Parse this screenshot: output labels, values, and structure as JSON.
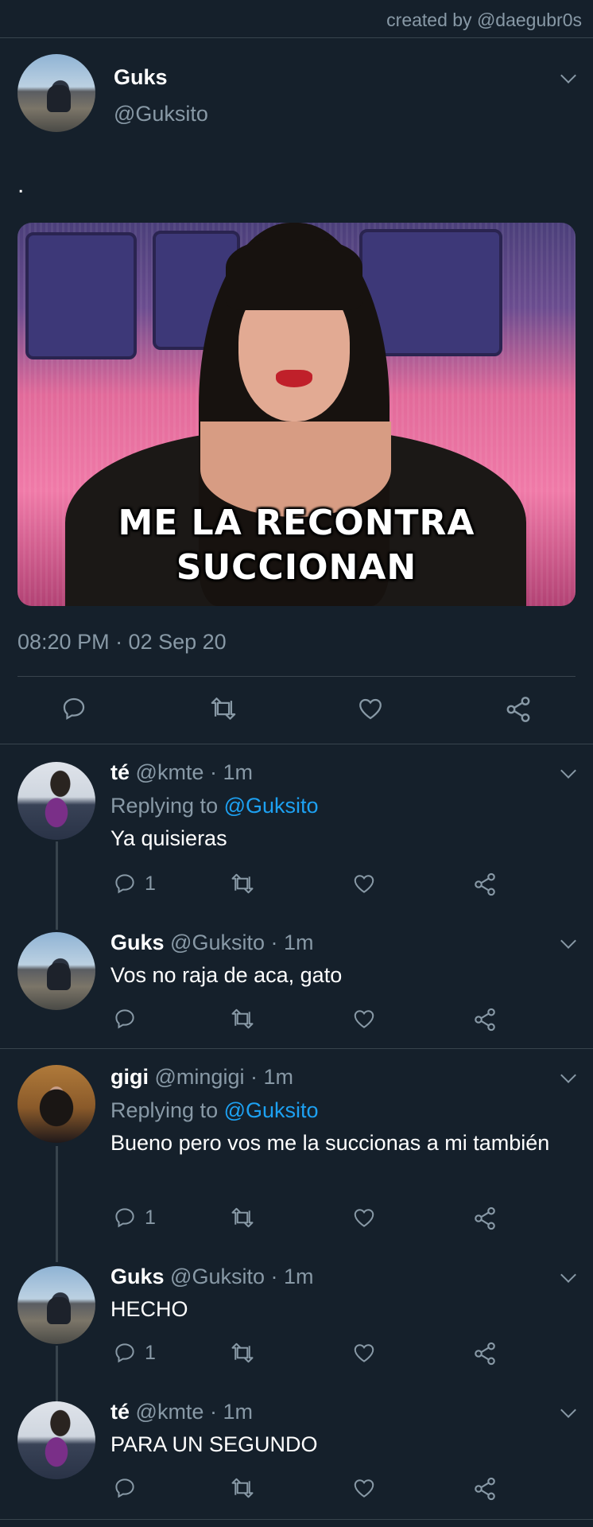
{
  "credit": "created by @daegubr0s",
  "main_tweet": {
    "name": "Guks",
    "handle": "@Guksito",
    "text": ".",
    "media_caption_line1": "ME LA RECONTRA",
    "media_caption_line2": "SUCCIONAN",
    "timestamp": "08:20 PM · 02 Sep 20",
    "actions": [
      "reply-icon",
      "retweet-icon",
      "like-icon",
      "share-icon"
    ]
  },
  "replies": [
    {
      "name": "té",
      "meta": "@kmte · 1m",
      "replying_prefix": "Replying to ",
      "replying_to": "@Guksito",
      "text": "Ya quisieras",
      "reply_count": "1"
    },
    {
      "name": "Guks",
      "meta": "@Guksito · 1m",
      "text": "Vos no raja de aca, gato",
      "reply_count": ""
    },
    {
      "name": "gigi",
      "meta": "@mingigi · 1m",
      "replying_prefix": "Replying to ",
      "replying_to": "@Guksito",
      "text": "Bueno pero vos me la succionas a mi también",
      "reply_count": "1"
    },
    {
      "name": "Guks",
      "meta": "@Guksito · 1m",
      "text": "HECHO",
      "reply_count": "1"
    },
    {
      "name": "té",
      "meta": "@kmte · 1m",
      "text": "PARA UN SEGUNDO",
      "reply_count": ""
    }
  ],
  "colors": {
    "background": "#15202b",
    "muted": "#8899a6",
    "link": "#1da1f2",
    "divider": "#38444d"
  }
}
